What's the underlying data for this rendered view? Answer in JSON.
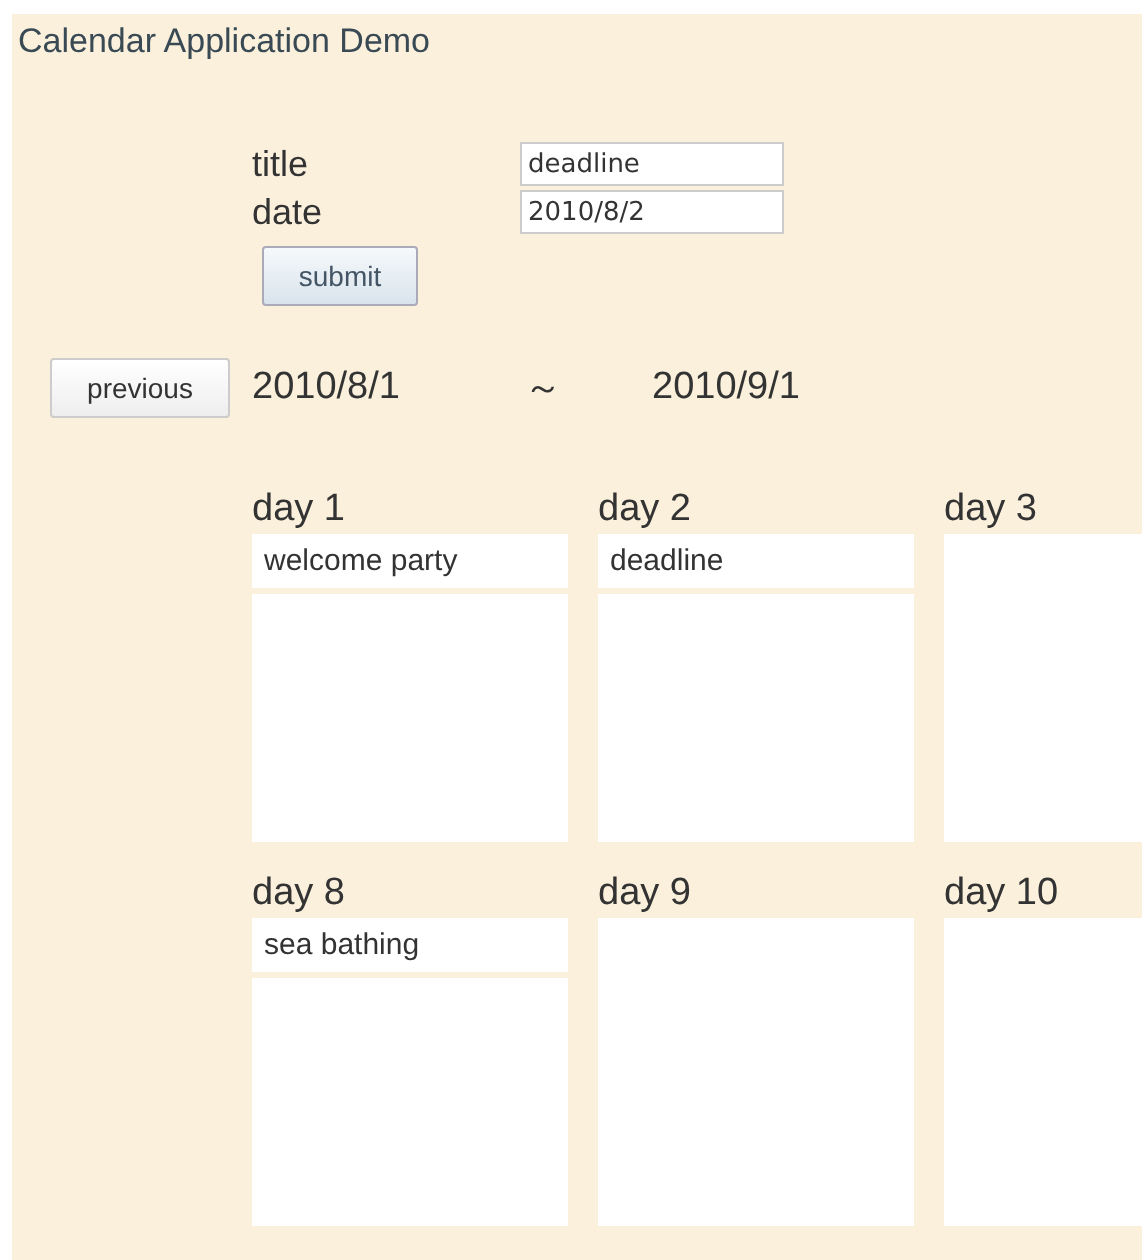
{
  "app_title": "Calendar Application Demo",
  "form": {
    "fields": [
      {
        "label": "title",
        "value": "deadline"
      },
      {
        "label": "date",
        "value": "2010/8/2"
      }
    ],
    "submit": "submit"
  },
  "range": {
    "previous": "previous",
    "start": "2010/8/1",
    "separator": "～",
    "end": "2010/9/1"
  },
  "days": [
    {
      "label": "day 1",
      "events": [
        "welcome party"
      ]
    },
    {
      "label": "day 2",
      "events": [
        "deadline"
      ]
    },
    {
      "label": "day 3"
    },
    {
      "label": "day 8",
      "events": [
        "sea bathing"
      ]
    },
    {
      "label": "day 9"
    },
    {
      "label": "day 10"
    }
  ]
}
